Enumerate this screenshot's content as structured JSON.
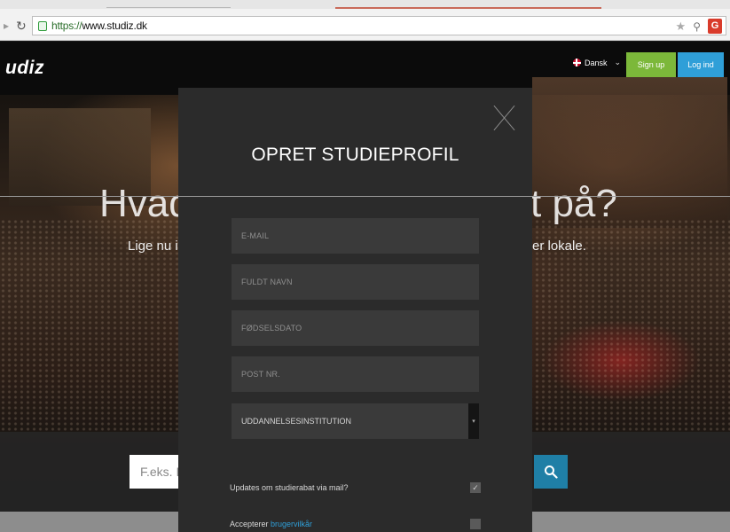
{
  "browser": {
    "url_scheme": "https://",
    "url_host": "www.studiz.dk",
    "extension_label": "G"
  },
  "site": {
    "brand": "udiz",
    "language": "Dansk",
    "signup_label": "Sign up",
    "login_label": "Log ind",
    "hero_left": "Hvad",
    "hero_right": "t på?",
    "subtitle_left": "Lige nu i",
    "subtitle_right": "er lokale.",
    "search_placeholder": "F.eks. I"
  },
  "modal": {
    "title": "OPRET STUDIEPROFIL",
    "fields": {
      "email": "E-MAIL",
      "name": "FULDT NAVN",
      "birthdate": "FØDSELSDATO",
      "postal": "POST NR.",
      "institution": "UDDANNELSESINSTITUTION"
    },
    "updates_label": "Updates om studierabat via mail?",
    "updates_checked": true,
    "accept_prefix": "Accepterer ",
    "accept_link": "brugervilkår",
    "accept_checked": false
  },
  "colors": {
    "signup": "#7cb83a",
    "login": "#2f9fd8",
    "search": "#1f7fa6",
    "modal_bg": "#2b2b2b"
  }
}
